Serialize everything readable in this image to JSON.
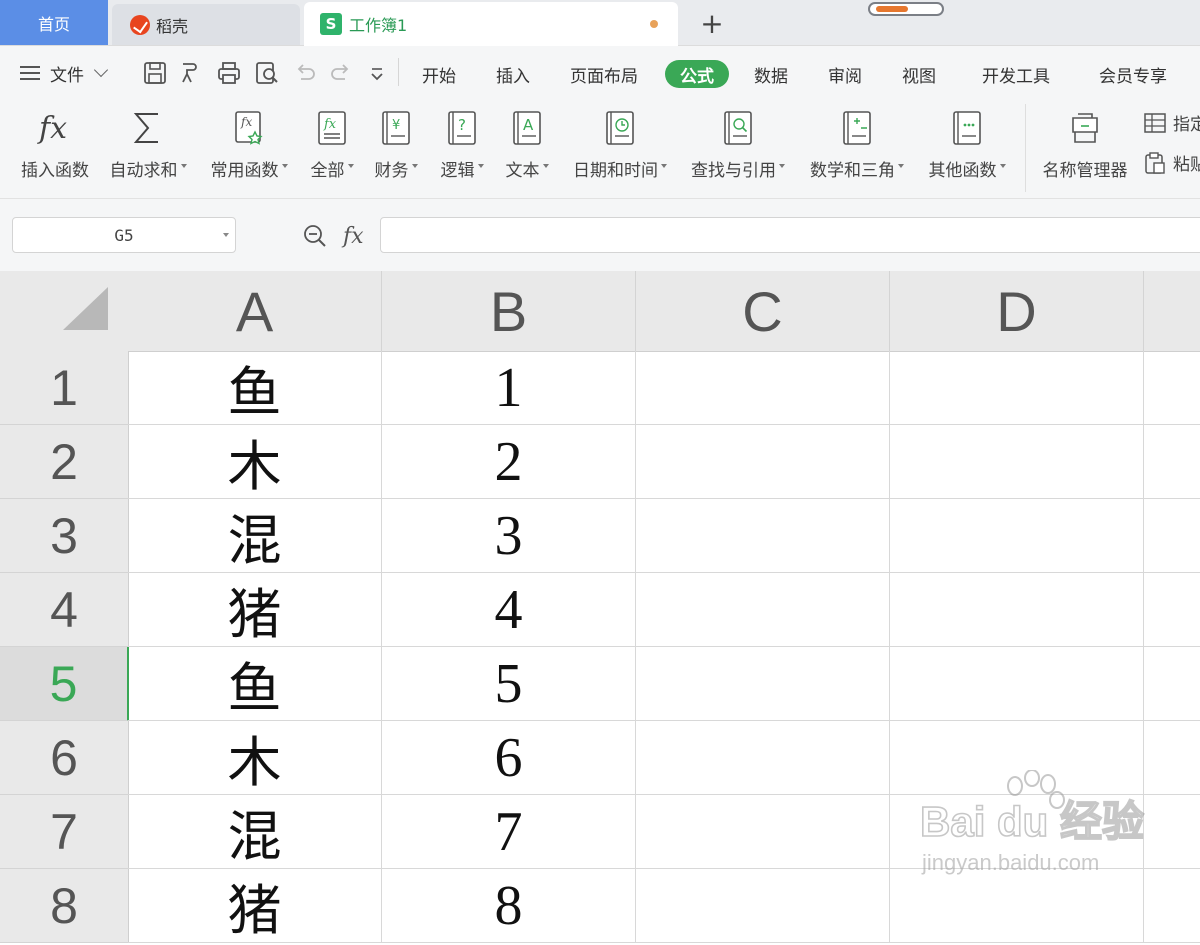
{
  "tabs": {
    "home": "首页",
    "daoke": "稻壳",
    "workbook": "工作簿1",
    "add": "+"
  },
  "menu": {
    "file": "文件",
    "tabs": [
      "开始",
      "插入",
      "页面布局",
      "公式",
      "数据",
      "审阅",
      "视图",
      "开发工具",
      "会员专享"
    ],
    "active_tab": "公式"
  },
  "ribbon": {
    "buttons": [
      {
        "label": "插入函数",
        "icon": "fx-icon"
      },
      {
        "label": "自动求和",
        "icon": "sigma-icon"
      },
      {
        "label": "常用函数",
        "icon": "star-function-icon"
      },
      {
        "label": "全部",
        "icon": "all-functions-icon"
      },
      {
        "label": "财务",
        "icon": "finance-icon"
      },
      {
        "label": "逻辑",
        "icon": "logic-icon"
      },
      {
        "label": "文本",
        "icon": "text-icon"
      },
      {
        "label": "日期和时间",
        "icon": "clock-icon"
      },
      {
        "label": "查找与引用",
        "icon": "lookup-icon"
      },
      {
        "label": "数学和三角",
        "icon": "math-icon"
      },
      {
        "label": "其他函数",
        "icon": "more-functions-icon"
      },
      {
        "label": "名称管理器",
        "icon": "name-manager-icon"
      }
    ],
    "small": [
      "指定",
      "粘贴"
    ]
  },
  "formula_bar": {
    "name_box": "G5",
    "fx_label": "fx",
    "content": ""
  },
  "grid": {
    "columns": [
      "A",
      "B",
      "C",
      "D"
    ],
    "rows": [
      {
        "num": "1",
        "A": "鱼",
        "B": "1"
      },
      {
        "num": "2",
        "A": "木",
        "B": "2"
      },
      {
        "num": "3",
        "A": "混",
        "B": "3"
      },
      {
        "num": "4",
        "A": "猪",
        "B": "4"
      },
      {
        "num": "5",
        "A": "鱼",
        "B": "5"
      },
      {
        "num": "6",
        "A": "木",
        "B": "6"
      },
      {
        "num": "7",
        "A": "混",
        "B": "7"
      },
      {
        "num": "8",
        "A": "猪",
        "B": "8"
      }
    ],
    "active_row": "5"
  },
  "watermark": {
    "brand": "Bai du 经验",
    "url": "jingyan.baidu.com"
  },
  "colors": {
    "accent_green": "#3aa856",
    "home_tab": "#5b8ee6"
  }
}
